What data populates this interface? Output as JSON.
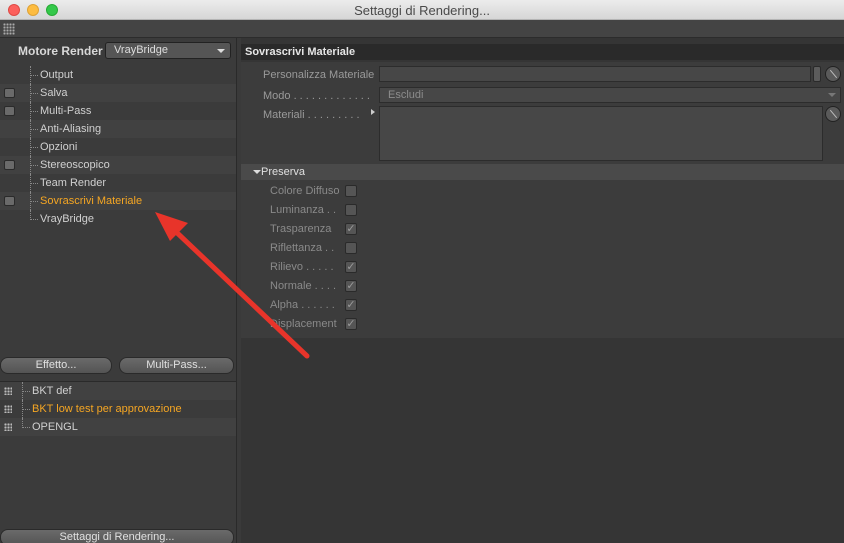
{
  "window": {
    "title": "Settaggi di Rendering..."
  },
  "left": {
    "engine_label": "Motore Render",
    "engine_value": "VrayBridge",
    "tree": [
      {
        "label": "Output",
        "checkbox": false,
        "active": false
      },
      {
        "label": "Salva",
        "checkbox": true,
        "active": false
      },
      {
        "label": "Multi-Pass",
        "checkbox": true,
        "active": false
      },
      {
        "label": "Anti-Aliasing",
        "checkbox": false,
        "active": false
      },
      {
        "label": "Opzioni",
        "checkbox": false,
        "active": false
      },
      {
        "label": "Stereoscopico",
        "checkbox": true,
        "active": false
      },
      {
        "label": "Team Render",
        "checkbox": false,
        "active": false
      },
      {
        "label": "Sovrascrivi Materiale",
        "checkbox": true,
        "active": true
      },
      {
        "label": "VrayBridge",
        "checkbox": false,
        "active": false
      }
    ],
    "effect_button": "Effetto...",
    "multipass_button": "Multi-Pass...",
    "presets": [
      {
        "label": "BKT def",
        "active": false
      },
      {
        "label": "BKT low test per approvazione",
        "active": true
      },
      {
        "label": "OPENGL",
        "active": false
      }
    ],
    "settings_button": "Settaggi di Rendering..."
  },
  "right": {
    "section_title": "Sovrascrivi Materiale",
    "personalizza_label": "Personalizza Materiale",
    "modo_label": "Modo . . . . . . . . . . . . .",
    "modo_value": "Escludi",
    "materiali_label": "Materiali . . . . . . . . .",
    "preserva_title": "Preserva",
    "preserva": [
      {
        "label": "Colore Diffuso",
        "checked": false
      },
      {
        "label": "Luminanza . .",
        "checked": false
      },
      {
        "label": "Trasparenza",
        "checked": true
      },
      {
        "label": "Riflettanza . .",
        "checked": false
      },
      {
        "label": "Rilievo . . . . .",
        "checked": true
      },
      {
        "label": "Normale . . . .",
        "checked": true
      },
      {
        "label": "Alpha . . . . . .",
        "checked": true
      },
      {
        "label": "Displacement",
        "checked": true
      }
    ]
  },
  "colors": {
    "accent": "#f5a623",
    "annotation_arrow": "#e8342a"
  }
}
